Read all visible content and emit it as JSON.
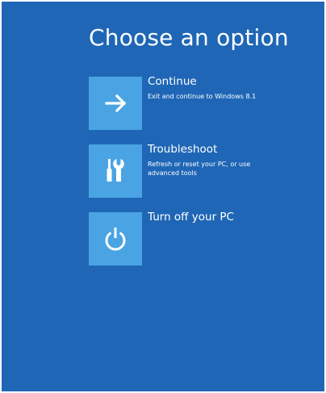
{
  "page": {
    "title": "Choose an option"
  },
  "options": [
    {
      "icon": "arrow-right-icon",
      "title": "Continue",
      "description": "Exit and continue to Windows 8.1"
    },
    {
      "icon": "tools-icon",
      "title": "Troubleshoot",
      "description": "Refresh or reset your PC, or use advanced tools"
    },
    {
      "icon": "power-icon",
      "title": "Turn off your PC",
      "description": ""
    }
  ],
  "colors": {
    "background": "#1f67b6",
    "tile": "#4aa4e3",
    "text": "#ffffff"
  }
}
